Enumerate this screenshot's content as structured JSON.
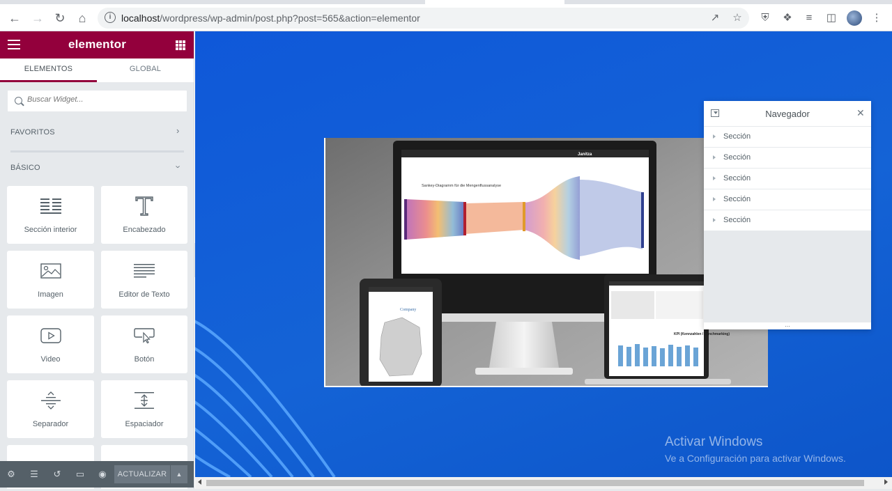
{
  "browser": {
    "url_host": "localhost",
    "url_path": "/wordpress/wp-admin/post.php?post=565&action=elementor"
  },
  "panel": {
    "brand": "elementor",
    "tabs": [
      "ELEMENTOS",
      "GLOBAL"
    ],
    "search_placeholder": "Buscar Widget...",
    "categories": {
      "favorites": "FAVORITOS",
      "basic": "BÁSICO"
    },
    "widgets": [
      {
        "label": "Sección interior",
        "icon": "inner-section-icon"
      },
      {
        "label": "Encabezado",
        "icon": "heading-icon"
      },
      {
        "label": "Imagen",
        "icon": "image-icon"
      },
      {
        "label": "Editor de Texto",
        "icon": "text-editor-icon"
      },
      {
        "label": "Video",
        "icon": "video-icon"
      },
      {
        "label": "Botón",
        "icon": "button-icon"
      },
      {
        "label": "Separador",
        "icon": "divider-icon"
      },
      {
        "label": "Espaciador",
        "icon": "spacer-icon"
      }
    ],
    "footer": {
      "update_label": "ACTUALIZAR"
    }
  },
  "navigator": {
    "title": "Navegador",
    "items": [
      "Sección",
      "Sección",
      "Sección",
      "Sección",
      "Sección"
    ]
  },
  "hero": {
    "chart_title": "Sankey-Diagramm für die Mengenflussanalyse",
    "brand": "Janitza",
    "tablet_brand": "Company",
    "laptop_title": "KPI (Kennzahlen / Benchmarking)"
  },
  "watermark": {
    "line1": "Activar Windows",
    "line2": "Ve a Configuración para activar Windows."
  },
  "colors": {
    "panel_header": "#93003c",
    "canvas_blue": "#1463d6",
    "footer": "#556068"
  }
}
